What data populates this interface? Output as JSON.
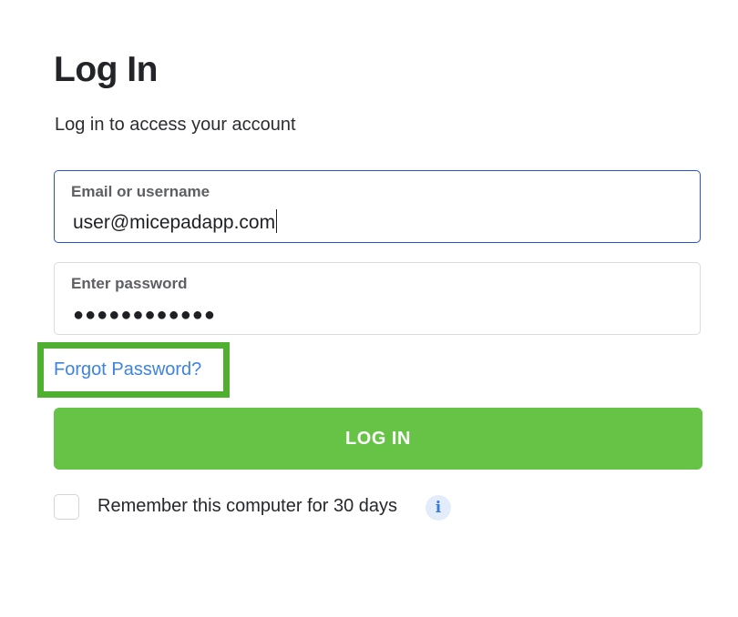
{
  "header": {
    "title": "Log In",
    "subtitle": "Log in to access your account"
  },
  "form": {
    "email": {
      "label": "Email or username",
      "value": "user@micepadapp.com",
      "focused": true
    },
    "password": {
      "label": "Enter password",
      "masked_value": "●●●●●●●●●●●●"
    },
    "forgot_password_label": "Forgot Password?",
    "submit_label": "LOG IN",
    "remember": {
      "label": "Remember this computer for 30 days",
      "checked": false,
      "info_icon": "info-icon"
    }
  },
  "colors": {
    "accent_green": "#66c345",
    "highlight_green": "#4faf2f",
    "link_blue": "#3d83e0",
    "focus_blue": "#2a53c9"
  }
}
